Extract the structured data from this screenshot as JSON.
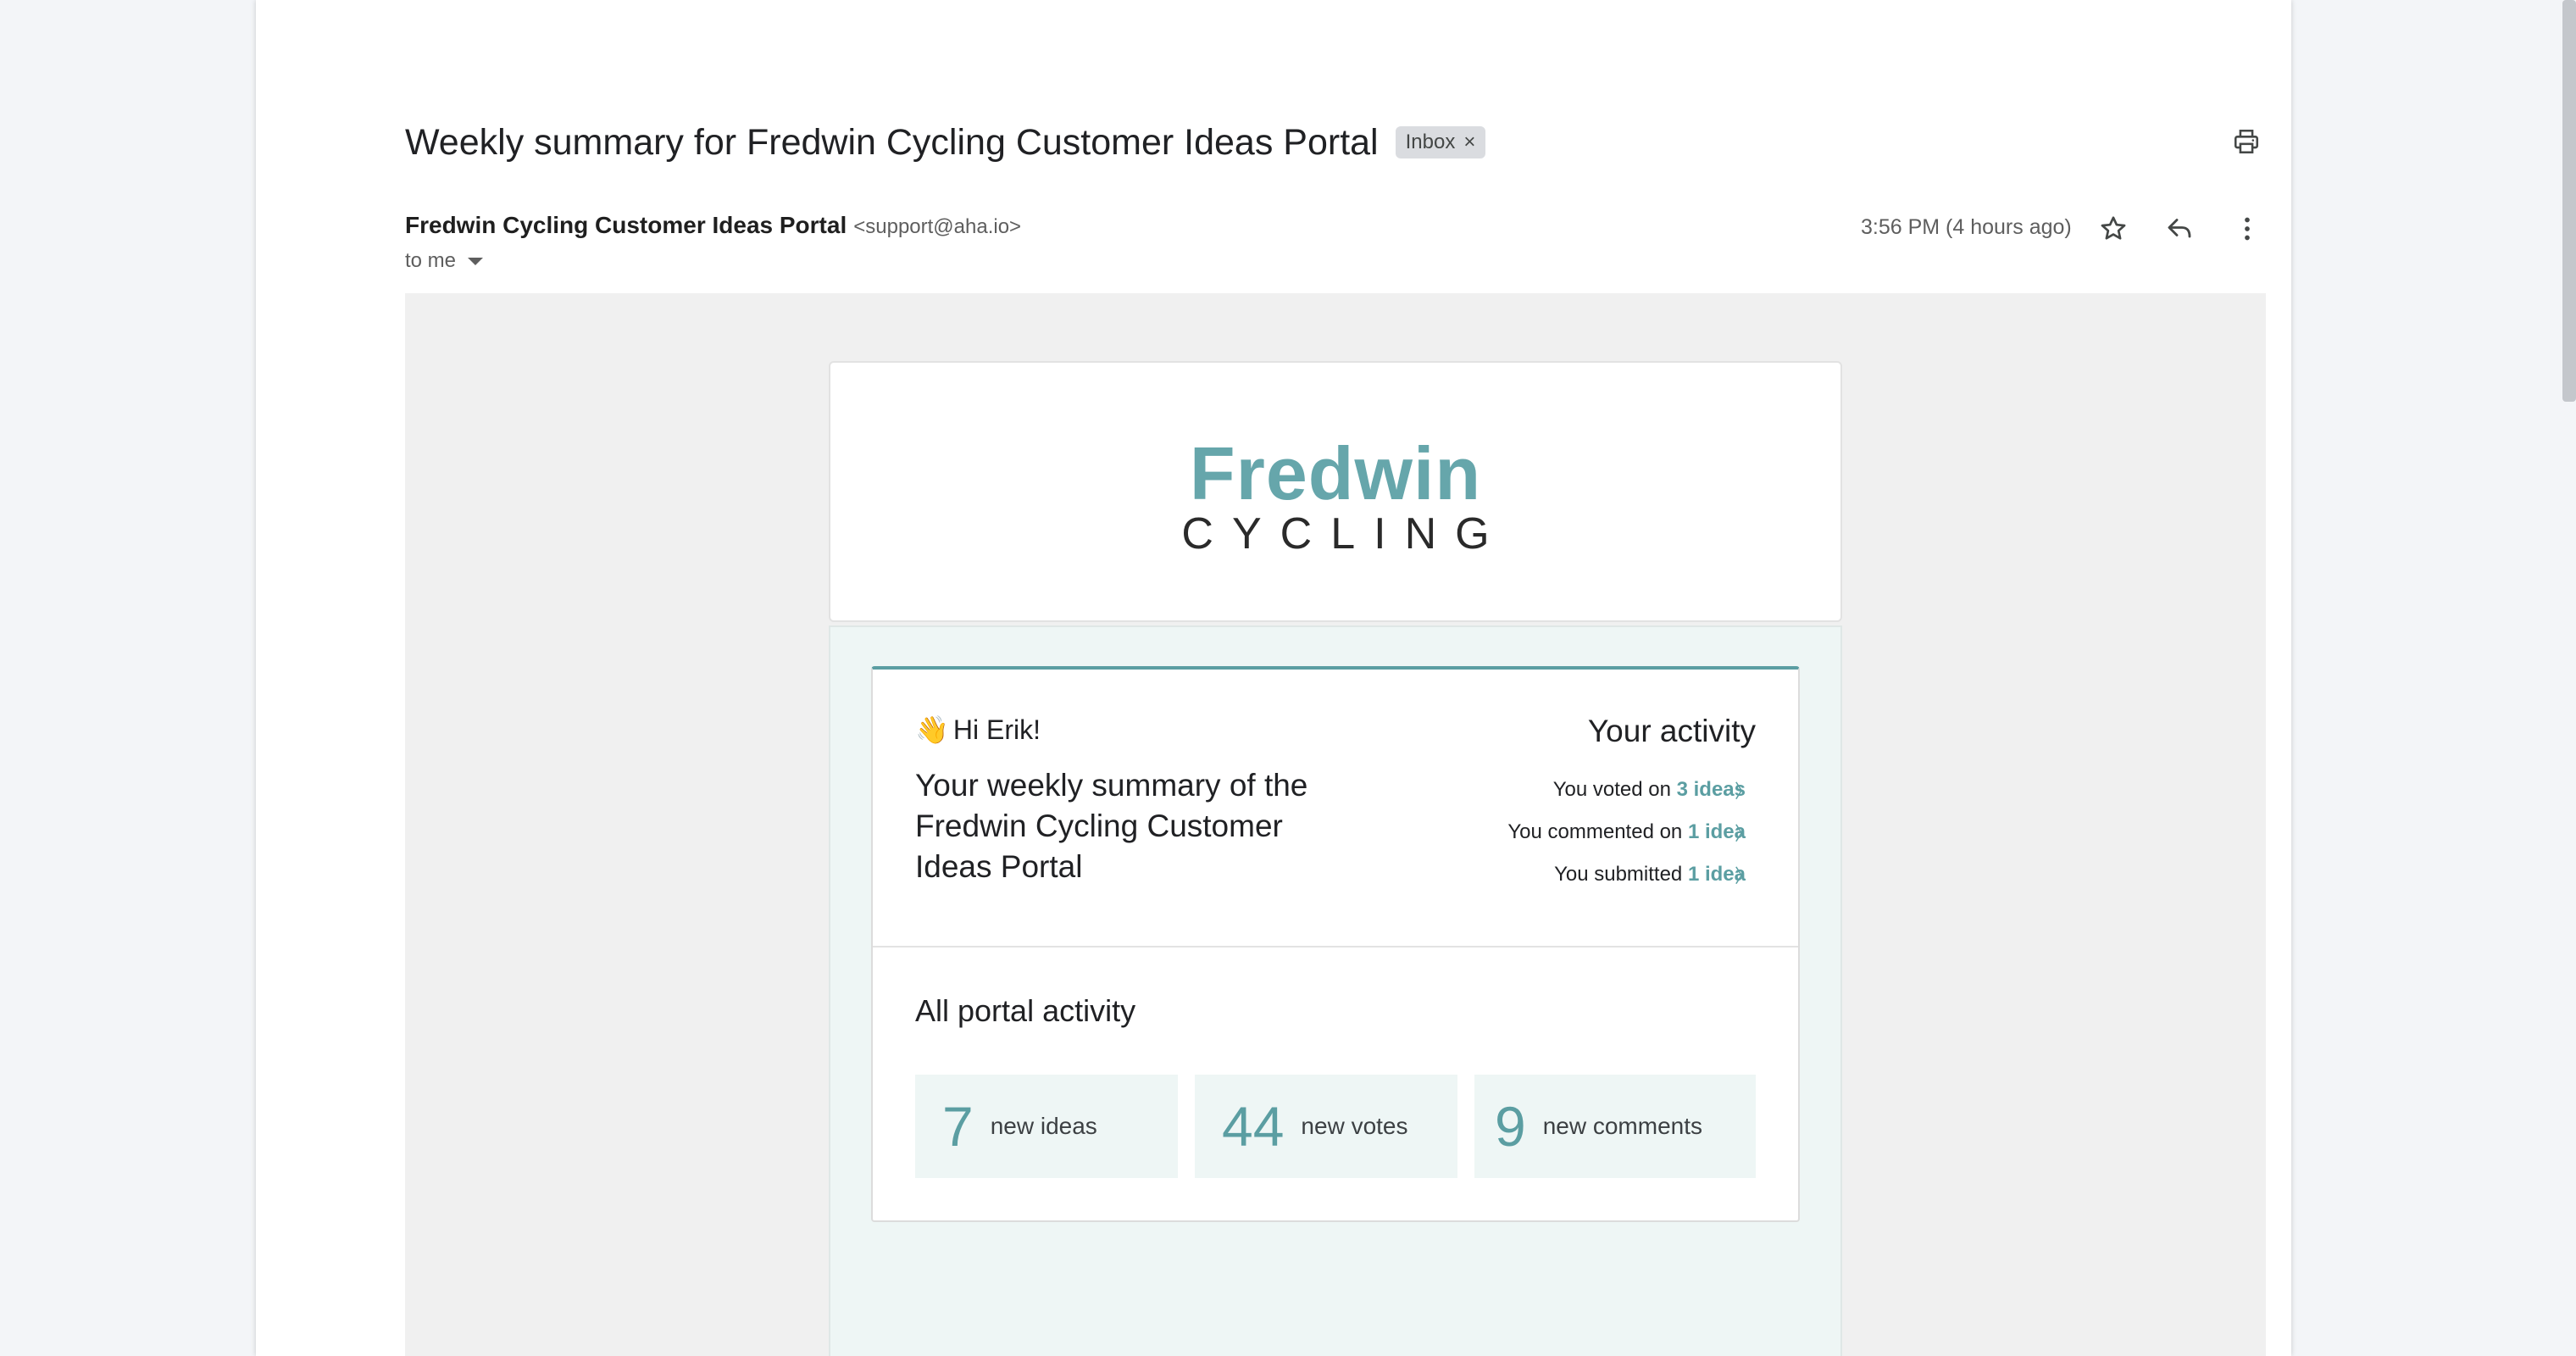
{
  "email": {
    "subject": "Weekly summary for Fredwin Cycling Customer Ideas Portal",
    "label_chip": "Inbox",
    "label_chip_close": "×",
    "sender_name": "Fredwin Cycling Customer Ideas Portal",
    "sender_email": "<support@aha.io>",
    "recipient": "to me",
    "timestamp": "3:56 PM (4 hours ago)",
    "icons": [
      "print-icon",
      "star-icon",
      "reply-icon",
      "more-vert-icon",
      "chevron-down-icon",
      "close-icon"
    ]
  },
  "logo": {
    "line1": "Fredwin",
    "line2": "CYCLING",
    "colors": {
      "fredwin": "#66a6ab",
      "cycling": "#2a2a2a"
    }
  },
  "summary": {
    "wave_emoji": "👋",
    "greeting": "Hi Erik!",
    "intro": "Your weekly summary of the Fredwin Cycling Customer Ideas Portal"
  },
  "your_activity": {
    "title": "Your activity",
    "items": [
      {
        "prefix": "You voted on",
        "link": "3 ideas",
        "arrow": "〉"
      },
      {
        "prefix": "You commented on",
        "link": "1 idea",
        "arrow": "〉"
      },
      {
        "prefix": "You submitted",
        "link": "1 idea",
        "arrow": "〉"
      }
    ]
  },
  "portal_activity": {
    "title": "All portal activity",
    "stats": [
      {
        "number": "7",
        "label": "new ideas"
      },
      {
        "number": "44",
        "label": "new votes"
      },
      {
        "number": "9",
        "label": "new comments"
      }
    ]
  },
  "colors": {
    "accent": "#5b9ea2",
    "panel_bg": "#eef6f5",
    "body_bg": "#f0f0f0"
  }
}
